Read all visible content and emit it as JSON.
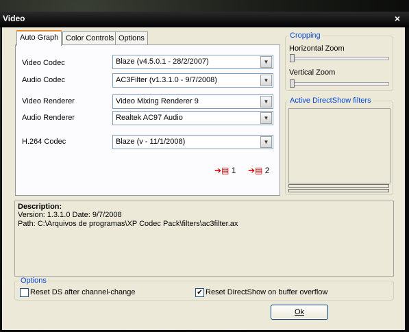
{
  "window": {
    "title": "Video",
    "close_glyph": "×"
  },
  "tabs": [
    "Auto Graph",
    "Color Controls",
    "Options"
  ],
  "codecs": [
    {
      "label": "Video Codec",
      "value": "Blaze   (v4.5.0.1 - 28/2/2007)"
    },
    {
      "label": "Audio Codec",
      "value": "AC3Filter   (v1.3.1.0 - 9/7/2008)"
    },
    {
      "label": "Video Renderer",
      "value": "Video Mixing Renderer 9"
    },
    {
      "label": "Audio Renderer",
      "value": "Realtek AC97 Audio"
    },
    {
      "label": "H.264 Codec",
      "value": "Blaze   (v - 11/1/2008)"
    }
  ],
  "graph_buttons": [
    {
      "icon": "graph-export-icon",
      "label": "1"
    },
    {
      "icon": "graph-export-icon",
      "label": "2"
    }
  ],
  "cropping": {
    "title": "Cropping",
    "horizontal_label": "Horizontal Zoom",
    "vertical_label": "Vertical Zoom",
    "horizontal_level": 0,
    "vertical_level": 0
  },
  "filters": {
    "title": "Active DirectShow filters"
  },
  "description": {
    "heading": "Description:",
    "line1": "Version: 1.3.1.0    Date: 9/7/2008",
    "line2": "Path: C:\\Arquivos de programas\\XP Codec Pack\\filters\\ac3filter.ax"
  },
  "options": {
    "title": "Options",
    "reset_ds_label": "Reset DS after channel-change",
    "reset_ds_checked": false,
    "reset_buffer_label": "Reset DirectShow on buffer overflow",
    "reset_buffer_checked": true
  },
  "ok_label": "Ok",
  "colors": {
    "accent": "#0046d5",
    "tab_highlight": "#e68b2c",
    "window_bg": "#ece9d8"
  }
}
